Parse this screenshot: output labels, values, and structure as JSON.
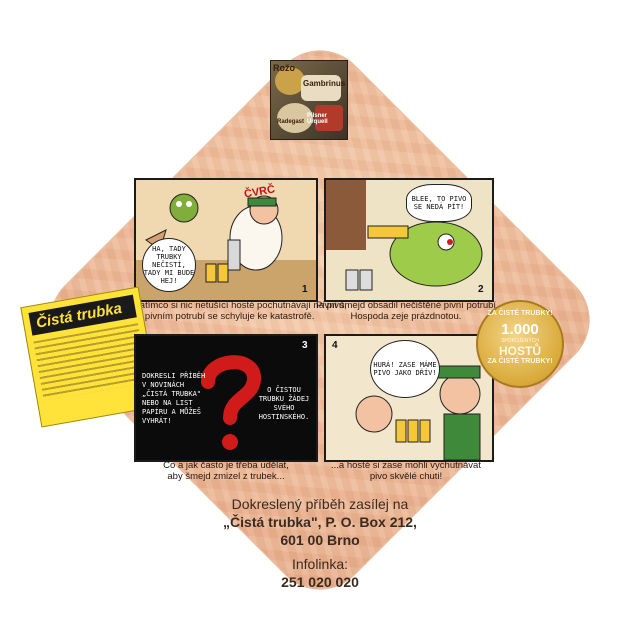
{
  "brand_logo": {
    "labels": [
      "Rožo",
      "Gambrinus",
      "Pilsner Urquell",
      "Radegast"
    ]
  },
  "panels": [
    {
      "number": "1",
      "shout": "ČVRČ",
      "speech": "HA, TADY TRUBKY NEČISTÍ, TADY MI BUDE HEJ!",
      "caption": [
        "Zatímco si nic netušící hosté pochutnávají na pivu,",
        "v pivním potrubí se schyluje ke katastrofě."
      ]
    },
    {
      "number": "2",
      "speech": "BLEE, TO PIVO SE NEDÁ PÍT!",
      "caption": [
        "Pivní šmejd obsadil nečištěné pivní potrubí.",
        "Hospoda zeje prázdnotou."
      ]
    },
    {
      "number": "3",
      "left_text": "DOKRESLI PŘÍBĚH V NOVINÁCH „ČISTÁ TRUBKA\" NEBO NA LIST PAPÍRU A MŮŽEŠ VYHRÁT!",
      "right_text": "O ČISTOU TRUBKU ŽÁDEJ SVÉHO HOSTINSKÉHO.",
      "caption": [
        "Co a jak často je třeba udělat,",
        "aby šmejd zmizel z trubek..."
      ]
    },
    {
      "number": "4",
      "speech": "HURÁ! ZASE MÁME PIVO JAKO DŘÍV!",
      "caption": [
        "...a hosté si zase mohli vychutnávat",
        "pivo skvělé chuti!"
      ]
    }
  ],
  "newspaper": {
    "title": "Čistá trubka"
  },
  "badge": {
    "top": "ZA ČISTÉ TRUBKY!",
    "number": "1.000",
    "middle": "SPOKOJENÝCH",
    "word": "HOSTŮ",
    "bottom": "ZA ČISTÉ TRUBKY!"
  },
  "footer": {
    "line1": "Dokreslený příběh zasílej na",
    "line2": "„Čistá trubka\", P. O. Box 212,",
    "line3": "601 00 Brno",
    "line4": "Infolinka:",
    "line5": "251 020 020"
  },
  "colors": {
    "coaster": "#efbb98",
    "newspaper": "#ffe23a",
    "badge": "#d9aa3a",
    "question_mark": "#d11a1a"
  }
}
